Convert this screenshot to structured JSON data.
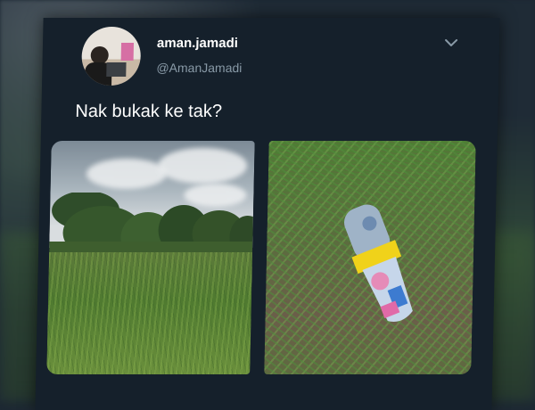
{
  "tweet": {
    "display_name": "aman.jamadi",
    "handle": "@AmanJamadi",
    "text": "Nak bukak ke tak?",
    "menu_icon": "chevron-down-icon"
  },
  "media": [
    {
      "name": "field-photo"
    },
    {
      "name": "bottle-photo"
    }
  ],
  "colors": {
    "card_bg": "#15202b",
    "primary_text": "#ffffff",
    "secondary_text": "#8899a6"
  }
}
